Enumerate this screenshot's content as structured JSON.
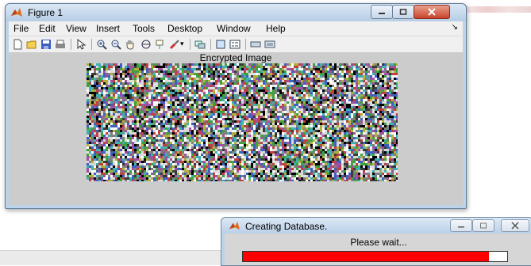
{
  "figure_window": {
    "title": "Figure 1",
    "menu": [
      "File",
      "Edit",
      "View",
      "Insert",
      "Tools",
      "Desktop",
      "Window",
      "Help"
    ],
    "menu_overflow_icon": "dock-arrow-icon",
    "toolbar": [
      "new-figure-icon",
      "open-file-icon",
      "save-icon",
      "print-icon",
      "pointer-icon",
      "zoom-in-icon",
      "zoom-out-icon",
      "pan-hand-icon",
      "rotate-3d-icon",
      "data-cursor-icon",
      "brush-icon",
      "link-plot-icon",
      "colorbar-icon",
      "legend-icon",
      "hide-plot-tools-icon",
      "show-plot-tools-icon"
    ],
    "axes_title": "Encrypted Image",
    "background": "#cccccc"
  },
  "progress_dialog": {
    "title": "Creating Database.",
    "message": "Please wait...",
    "progress_fraction": 0.93,
    "bar_color": "#ff0000"
  }
}
